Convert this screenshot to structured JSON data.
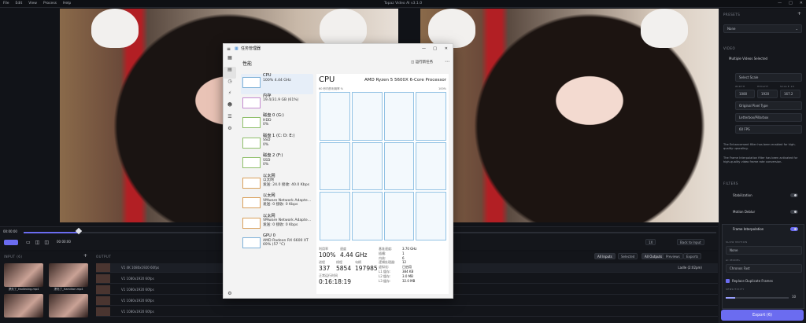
{
  "titlebar": {
    "menu": [
      "File",
      "Edit",
      "View",
      "Process",
      "Help"
    ],
    "title": "Topaz Video AI  v3.1.0"
  },
  "right_panel": {
    "presets_label": "PRESETS",
    "preset_value": "None",
    "video_label": "VIDEO",
    "multiple_videos": "Multiple Videos Selected",
    "output_size": "Select Scale",
    "width_label": "WIDTH",
    "width_value": "1080",
    "height_label": "HEIGHT",
    "height_value": "1920",
    "scale_label": "SCALE 2X",
    "scale_value": "167.2",
    "pixel_type": "Original Pixel Type",
    "pixel_format": "Letterbox/Pillarbox",
    "fps": "60 FPS",
    "note1": "The Enhancement filter has been enabled for high-quality upscaling.",
    "note2": "The Frame Interpolation filter has been activated for high-quality video frame rate conversion.",
    "filters_label": "FILTERS",
    "stabilization": "Stabilization",
    "motion_deblur": "Motion Deblur",
    "frame_interp": "Frame Interpolation",
    "slowmo_label": "SLOW MOTION",
    "slowmo_value": "None",
    "ai_model_label": "AI MODEL",
    "ai_model_value": "Chronos Fast",
    "dup_frames": "Replace Duplicate Frames",
    "sensitivity_label": "SENSITIVITY",
    "sensitivity_value": "10",
    "export": "Export (6)"
  },
  "timeline": {
    "start": "00:00:00",
    "end": "00:00:00",
    "back": "Back to Input",
    "zoom": "1X",
    "progress": 0.08
  },
  "bottom": {
    "input_label": "INPUT (6)",
    "output_label": "OUTPUT",
    "input_files": [
      "漂亮了_Hadlexing.mp4",
      "漂亮了_Hamilton.mp4"
    ],
    "tabs_left": [
      "All Inputs",
      "Selected"
    ],
    "tabs_right": [
      "All Outputs",
      "Previews",
      "Exports"
    ],
    "rows": [
      {
        "text": "V1  4K  1080x1920  60fps",
        "status": "Ladle (2:02pm)"
      },
      {
        "text": "V1  1080x1920  60fps",
        "status": ""
      },
      {
        "text": "V1  1080x1920  60fps",
        "status": ""
      },
      {
        "text": "V1  1080x1920  60fps",
        "status": ""
      },
      {
        "text": "V1  1080x1920  60fps",
        "status": ""
      }
    ]
  },
  "taskmgr": {
    "title": "任务管理器",
    "header": "性能",
    "run_task": "运行新任务",
    "items": [
      {
        "name": "CPU",
        "sub1": "100% 4.44 GHz",
        "sub2": ""
      },
      {
        "name": "内存",
        "sub1": "19.4/31.9 GB (61%)",
        "sub2": ""
      },
      {
        "name": "磁盘 0 (G:)",
        "sub1": "HDD",
        "sub2": "0%"
      },
      {
        "name": "磁盘 1 (C: D: E:)",
        "sub1": "SSD",
        "sub2": "0%"
      },
      {
        "name": "磁盘 2 (F:)",
        "sub1": "SSD",
        "sub2": "0%"
      },
      {
        "name": "以太网",
        "sub1": "以太网",
        "sub2": "发送: 24.0 接收: 40.0 Kbps"
      },
      {
        "name": "以太网",
        "sub1": "VMware Network Adapte...",
        "sub2": "发送: 0 接收: 0 Kbps"
      },
      {
        "name": "以太网",
        "sub1": "VMware Network Adapte...",
        "sub2": "发送: 0 接收: 0 Kbps"
      },
      {
        "name": "GPU 0",
        "sub1": "AMD Radeon RX 6600 XT",
        "sub2": "69% (57 °C)"
      }
    ],
    "cpu_title": "CPU",
    "cpu_name": "AMD Ryzen 5 5600X 6-Core Processor",
    "graph_left": "60 秒内的利用率 %",
    "graph_right": "100%",
    "util_label": "利用率",
    "util": "100%",
    "speed_label": "速度",
    "speed": "4.44 GHz",
    "proc_label": "进程",
    "proc": "337",
    "thread_label": "线程",
    "thread": "5854",
    "handle_label": "句柄",
    "handle": "197985",
    "uptime_label": "正常运行时间",
    "uptime": "0:16:18:19",
    "specs": [
      [
        "基准速度:",
        "3.70 GHz"
      ],
      [
        "插槽:",
        "1"
      ],
      [
        "内核:",
        "6"
      ],
      [
        "逻辑处理器:",
        "12"
      ],
      [
        "虚拟化:",
        "已启用"
      ],
      [
        "L1 缓存:",
        "384 KB"
      ],
      [
        "L2 缓存:",
        "3.0 MB"
      ],
      [
        "L3 缓存:",
        "32.0 MB"
      ]
    ]
  }
}
